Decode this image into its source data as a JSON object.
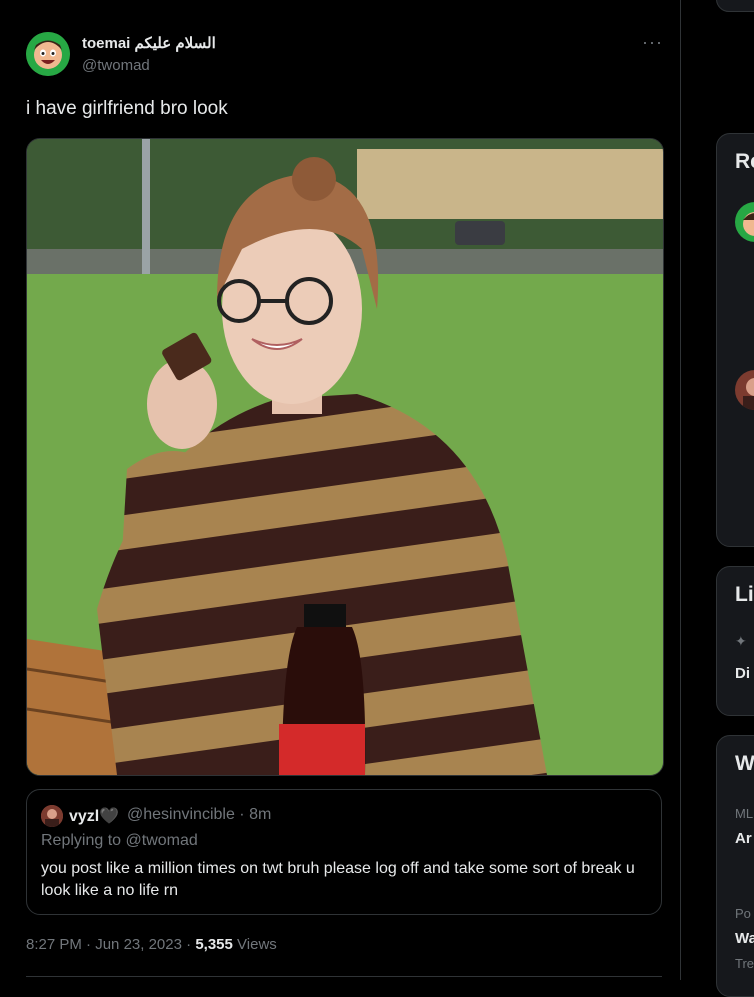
{
  "tweet": {
    "display_name": "toemai السلام عليكم",
    "handle": "@twomad",
    "more_label": "···",
    "text": "i have girlfriend bro look",
    "time": "8:27 PM",
    "date": "Jun 23, 2023",
    "views_count": "5,355",
    "views_label": "Views"
  },
  "quote": {
    "name": "vyzl🖤",
    "handle": "@hesinvincible · 8m",
    "replying_prefix": "Replying to ",
    "replying_to": "@twomad",
    "text": "you post like a million times on twt bruh please log off and take some sort of break u look like a no life rn"
  },
  "sidebar": {
    "card1_title": "Re",
    "card2_title": "Li",
    "card2_item": "Di",
    "card3_title": "W",
    "card3_small1": "ML",
    "card3_bold1": "Ar",
    "card3_small2": "Po",
    "card3_bold2": "Wa",
    "card3_small3": "Tre"
  },
  "colors": {
    "background": "#000000",
    "text": "#e7e9ea",
    "muted": "#71767b",
    "border": "#2f3336"
  }
}
